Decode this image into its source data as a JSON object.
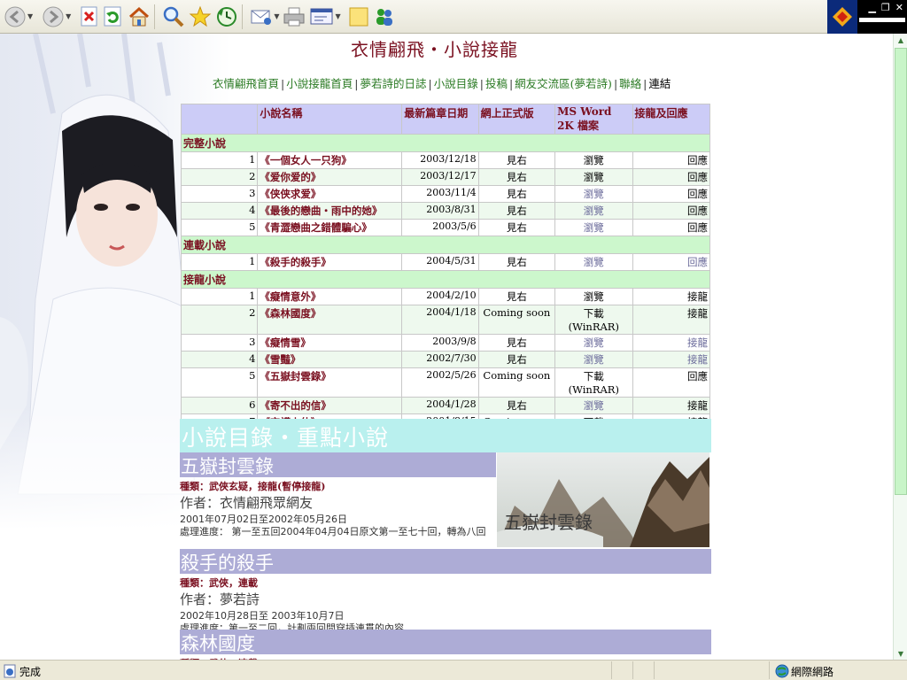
{
  "toolbar": {
    "buttons": [
      "back",
      "forward",
      "stop",
      "refresh",
      "home",
      "search",
      "favorites",
      "history",
      "mail",
      "print",
      "edit",
      "discuss",
      "messenger"
    ]
  },
  "page": {
    "title": "衣情翩飛・小說接龍",
    "nav": [
      "衣情翩飛首頁",
      "小說接龍首頁",
      "夢若詩的日誌",
      "小說目錄",
      "投稿",
      "網友交流區(夢若詩)",
      "聯絡",
      "連結"
    ]
  },
  "table": {
    "headers": [
      "",
      "小說名稱",
      "最新篇章日期",
      "網上正式版",
      "MS Word 2K 檔案",
      "接龍及回應"
    ],
    "sections": [
      {
        "label": "完整小說",
        "rows": [
          {
            "num": "1",
            "name": "《一個女人一只狗》",
            "date": "2003/12/18",
            "ver": "見右",
            "ms": "瀏覽",
            "reply": "回應"
          },
          {
            "num": "2",
            "name": "《爱你爱的》",
            "date": "2003/12/17",
            "ver": "見右",
            "ms": "瀏覽",
            "reply": "回應"
          },
          {
            "num": "3",
            "name": "《侠侠求爱》",
            "date": "2003/11/4",
            "ver": "見右",
            "ms": "瀏覽",
            "reply": "回應"
          },
          {
            "num": "4",
            "name": "《最後的戀曲・雨中的她》",
            "date": "2003/8/31",
            "ver": "見右",
            "ms": "瀏覽",
            "reply": "回應"
          },
          {
            "num": "5",
            "name": "《青澀戀曲之錯體騙心》",
            "date": "2003/5/6",
            "ver": "見右",
            "ms": "瀏覽",
            "reply": "回應"
          }
        ]
      },
      {
        "label": "連載小說",
        "rows": [
          {
            "num": "1",
            "name": "《殺手的殺手》",
            "date": "2004/5/31",
            "ver": "見右",
            "ms": "瀏覽",
            "reply": "回應"
          }
        ]
      },
      {
        "label": "接龍小說",
        "rows": [
          {
            "num": "1",
            "name": "《癡情意外》",
            "date": "2004/2/10",
            "ver": "見右",
            "ms": "瀏覽",
            "reply": "接龍"
          },
          {
            "num": "2",
            "name": "《森林國度》",
            "date": "2004/1/18",
            "ver": "Coming soon",
            "ms": "下載 (WinRAR)",
            "reply": "接龍"
          },
          {
            "num": "3",
            "name": "《癡情雪》",
            "date": "2003/9/8",
            "ver": "見右",
            "ms": "瀏覽",
            "reply": "接龍"
          },
          {
            "num": "4",
            "name": "《雪豔》",
            "date": "2002/7/30",
            "ver": "見右",
            "ms": "瀏覽",
            "reply": "接龍"
          },
          {
            "num": "5",
            "name": "《五嶽封雲錄》",
            "date": "2002/5/26",
            "ver": "Coming soon",
            "ms": "下載 (WinRAR)",
            "reply": "回應"
          },
          {
            "num": "6",
            "name": "《寄不出的信》",
            "date": "2004/1/28",
            "ver": "見右",
            "ms": "瀏覽",
            "reply": "接龍"
          },
          {
            "num": "7",
            "name": "《守護少俠》",
            "date": "2001/8/15",
            "ver": "Coming soon",
            "ms": "下載 (WinRAR)",
            "reply": "接龍"
          }
        ]
      }
    ]
  },
  "catalog": {
    "heading": "小說目錄・重點小說",
    "novels": [
      {
        "title": "五嶽封雲錄",
        "type": "種類：武俠玄疑，接龍(暫停接龍)",
        "author": "作者：衣情翩飛眾網友",
        "dates": "2001年07月02日至2002年05月26日",
        "progress": "處理進度：  第一至五回2004年04月04日原文第一至七十回，轉為八回",
        "cover_text": "五嶽封雲錄"
      },
      {
        "title": "殺手的殺手",
        "type": "種類：武俠，連載",
        "author": "作者：夢若詩",
        "dates": "2002年10月28日至 2003年10月7日",
        "progress": "處理進度：第一至二回，計劃兩回間穿插連貫的內容"
      },
      {
        "title": "森林國度",
        "type": "種類：武俠，連載"
      }
    ]
  },
  "status": {
    "text": "完成",
    "zone": "網際網路"
  }
}
